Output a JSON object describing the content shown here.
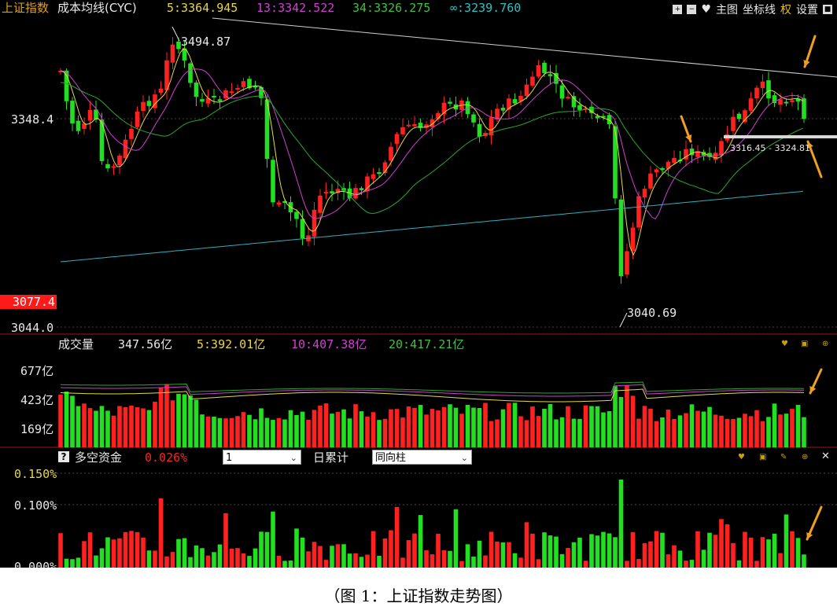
{
  "main": {
    "title": "上证指数",
    "indicator": "成本均线(CYC)",
    "ma_labels": [
      {
        "text": "5:3364.945",
        "color": "#e6d84a"
      },
      {
        "text": "13:3342.522",
        "color": "#d040d0"
      },
      {
        "text": "34:3326.275",
        "color": "#40c040"
      },
      {
        "text": "∞:3239.760",
        "color": "#30c0c0"
      }
    ],
    "toolbar": {
      "plus": "+",
      "minus": "−",
      "heart": "♥",
      "main_chart": "主图",
      "axis": "坐标线",
      "quan": "权",
      "settings": "设置"
    },
    "y_labels": {
      "top": "3348.4",
      "low": "3044.0",
      "current": "3077.4"
    },
    "high_label": "3494.87",
    "low_label": "3040.69",
    "band_label": "3316.45 - 3324.81"
  },
  "volume": {
    "title": "成交量",
    "value": "347.56亿",
    "ma5": "5:392.01亿",
    "ma10": "10:407.38亿",
    "ma20": "20:417.21亿",
    "y_labels": [
      "677亿",
      "423亿",
      "169亿"
    ]
  },
  "capital": {
    "help": "?",
    "title": "多空资金",
    "value": "0.026%",
    "period_value": "1",
    "accum_label": "日累计",
    "mode_value": "同向柱",
    "y_labels": [
      "0.150%",
      "0.100%",
      "0.000%"
    ]
  },
  "caption": "（图 1：上证指数走势图）",
  "colors": {
    "up": "#ff2020",
    "down": "#20e020",
    "background": "#000000"
  },
  "chart_data": {
    "type": "candlestick",
    "title": "上证指数",
    "y_axis_ticks": [
      3348.4,
      3077.4,
      3044.0
    ],
    "annotations": [
      "3494.87",
      "3040.69",
      "3316.45 - 3324.81"
    ]
  }
}
